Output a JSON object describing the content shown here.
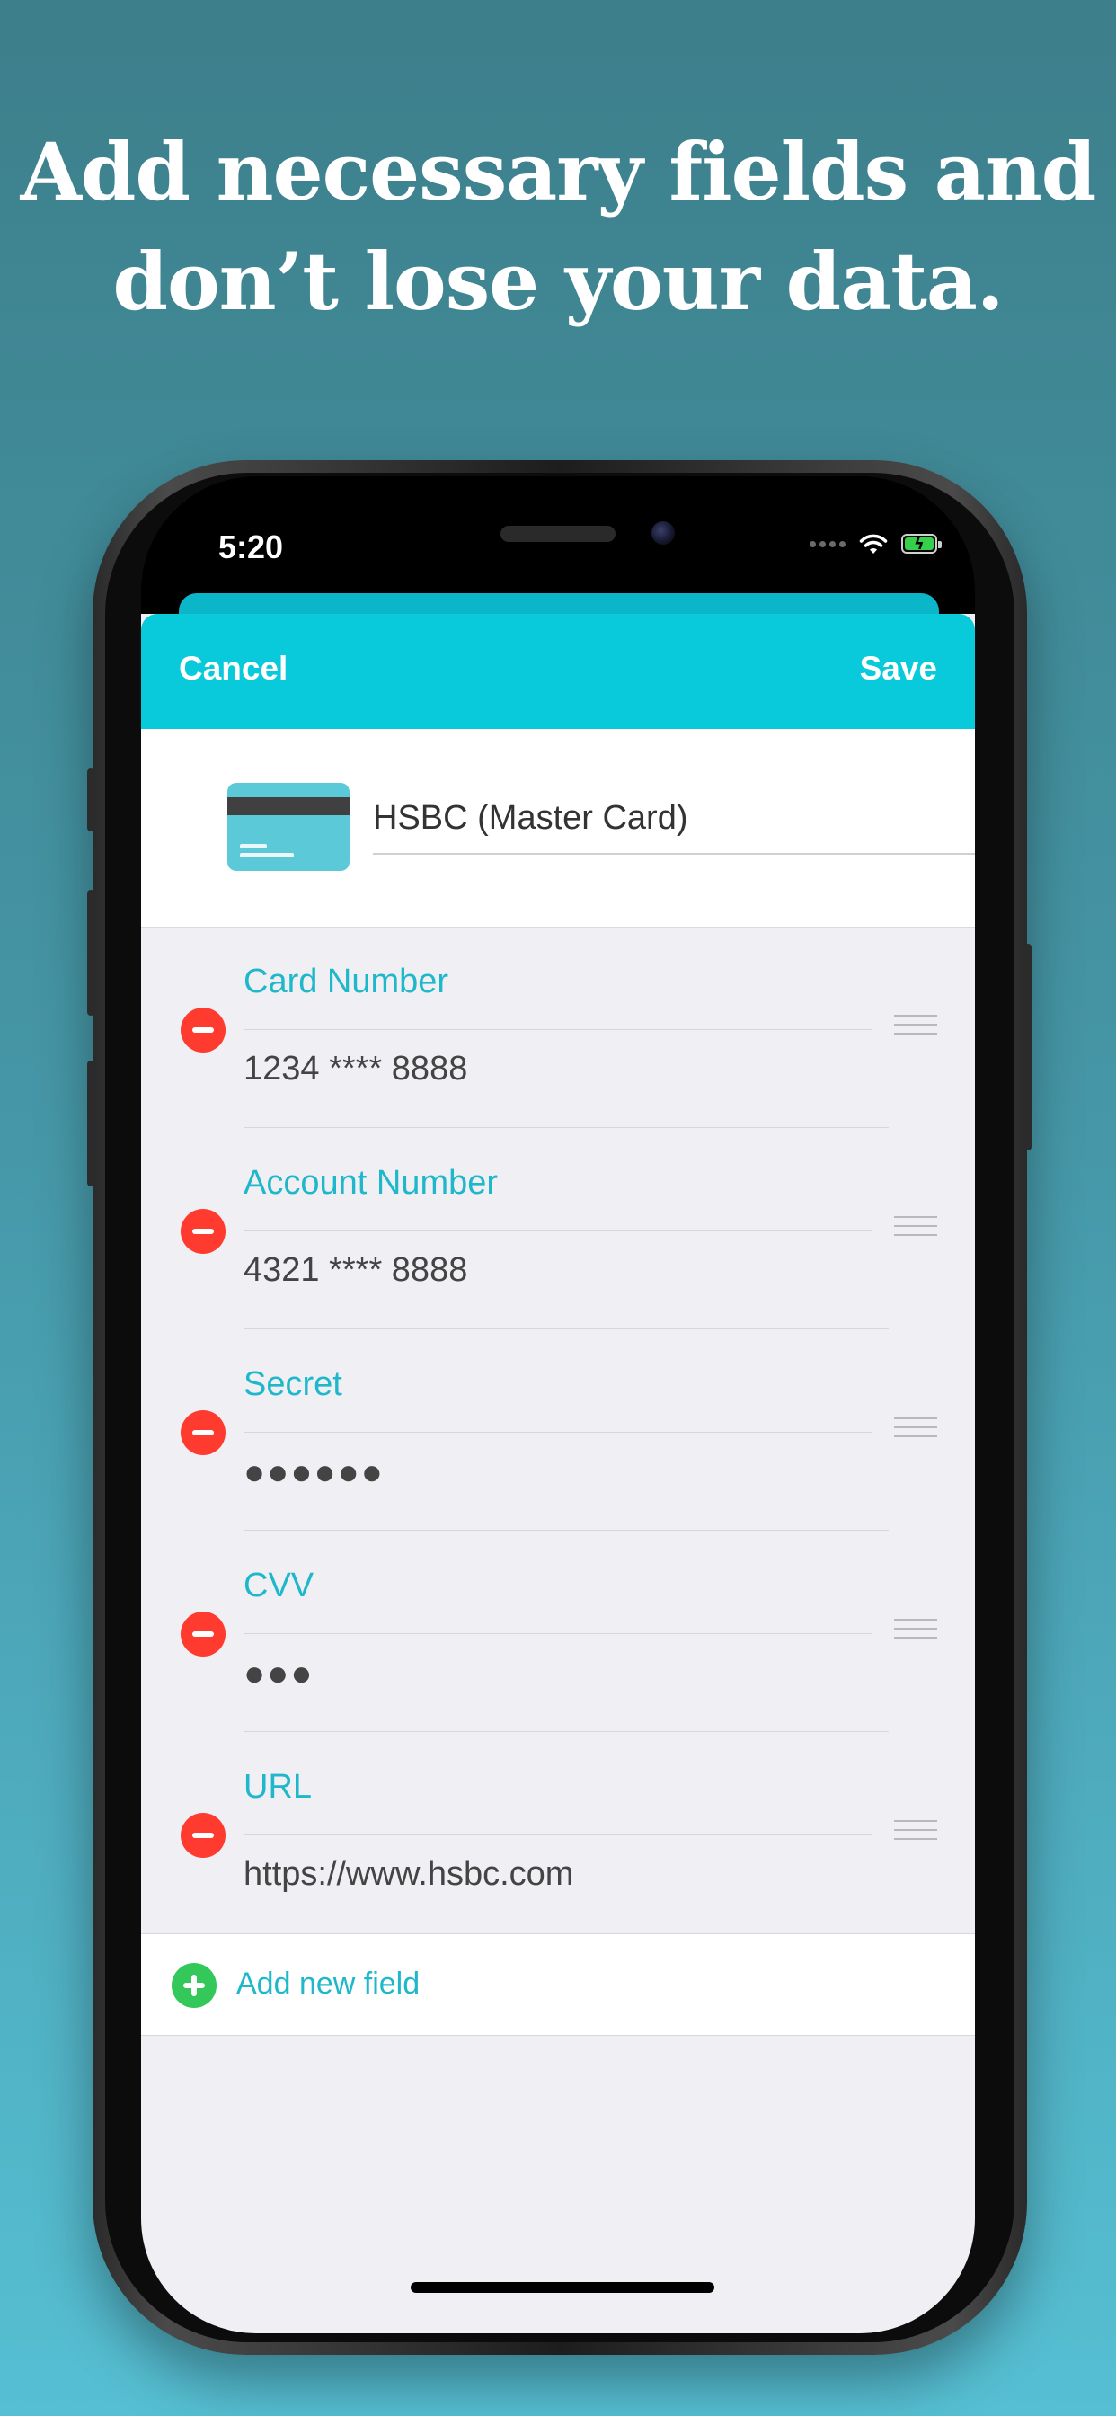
{
  "headline": {
    "line1": "Add necessary fields and",
    "line2": "don’t lose your data."
  },
  "status_bar": {
    "time": "5:20",
    "icons": [
      "signal-dots-icon",
      "wifi-icon",
      "battery-charging-icon"
    ]
  },
  "navbar": {
    "cancel_label": "Cancel",
    "save_label": "Save",
    "accent_color": "#08cadb"
  },
  "entry": {
    "icon": "credit-card-icon",
    "title": "HSBC (Master Card)"
  },
  "fields": [
    {
      "label": "Card Number",
      "value": "1234 **** 8888"
    },
    {
      "label": "Account Number",
      "value": "4321 **** 8888"
    },
    {
      "label": "Secret",
      "value": "●●●●●●"
    },
    {
      "label": "CVV",
      "value": "●●●"
    },
    {
      "label": "URL",
      "value": "https://www.hsbc.com"
    }
  ],
  "add_field": {
    "label": "Add new field",
    "icon": "plus-circle-icon"
  },
  "colors": {
    "remove": "#ff3b30",
    "add": "#34c759",
    "label": "#1fb8cb"
  }
}
